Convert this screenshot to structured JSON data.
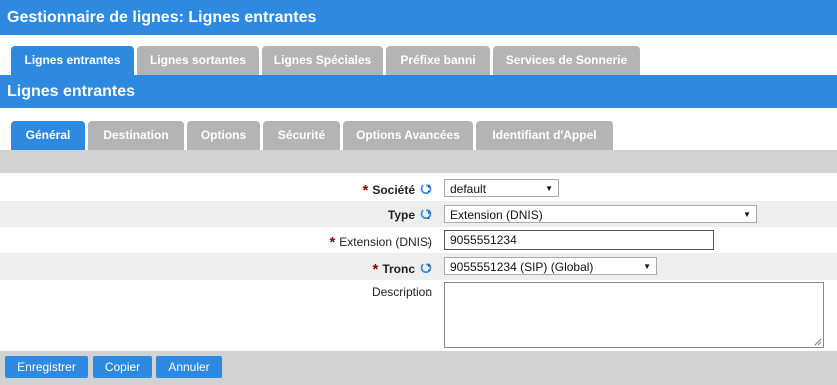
{
  "title": "Gestionnaire de lignes:  Lignes entrantes",
  "top_tabs": [
    {
      "label": "Lignes entrantes",
      "active": true
    },
    {
      "label": "Lignes sortantes",
      "active": false
    },
    {
      "label": "Lignes Spéciales",
      "active": false
    },
    {
      "label": "Préfixe banni",
      "active": false
    },
    {
      "label": "Services de Sonnerie",
      "active": false
    }
  ],
  "section_title": "Lignes entrantes",
  "sub_tabs": [
    {
      "label": "Général",
      "active": true
    },
    {
      "label": "Destination",
      "active": false
    },
    {
      "label": "Options",
      "active": false
    },
    {
      "label": "Sécurité",
      "active": false
    },
    {
      "label": "Options Avancées",
      "active": false
    },
    {
      "label": "Identifiant d'Appel",
      "active": false
    }
  ],
  "form": {
    "societe": {
      "label": "Société",
      "required": true,
      "value": "default"
    },
    "type": {
      "label": "Type",
      "required": false,
      "value": "Extension (DNIS)"
    },
    "extension": {
      "label": "Extension (DNIS)",
      "required": true,
      "value": "9055551234"
    },
    "tronc": {
      "label": "Tronc",
      "required": true,
      "value": "9055551234 (SIP) (Global)"
    },
    "description": {
      "label": "Description",
      "value": ""
    },
    "required_marker": "*",
    "separator": ":"
  },
  "buttons": {
    "save": "Enregistrer",
    "copy": "Copier",
    "cancel": "Annuler"
  },
  "colors": {
    "accent": "#2d8ae0",
    "inactive_tab": "#b4b4b4",
    "required_star": "#8b0000"
  }
}
